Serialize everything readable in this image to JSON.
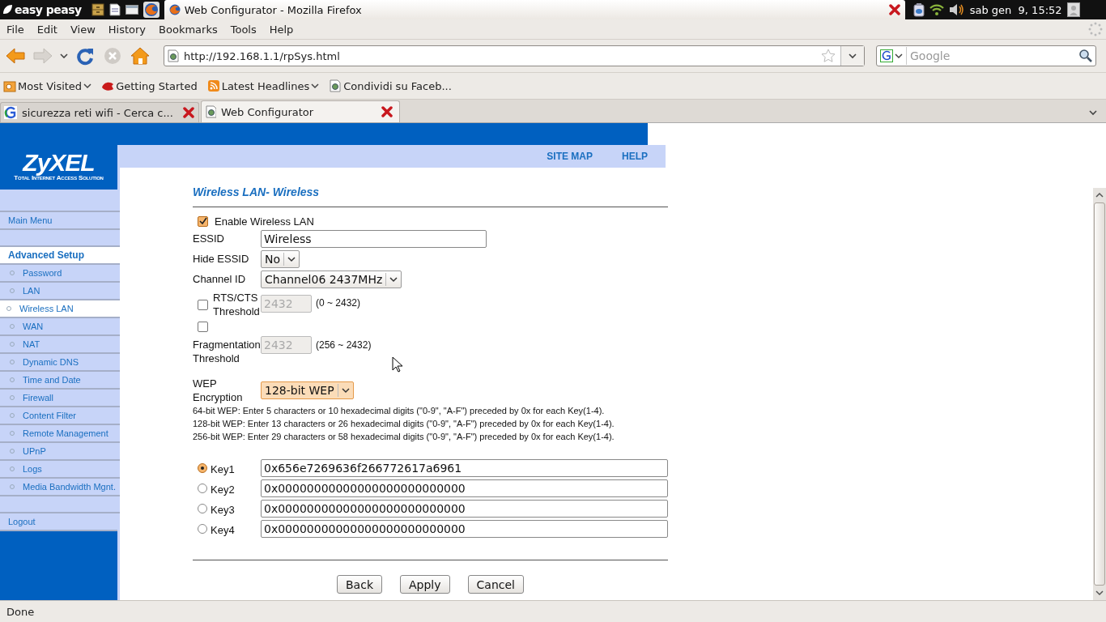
{
  "panel": {
    "menu_label": "easy peasy",
    "window_title": "Web Configurator - Mozilla Firefox",
    "clock": "sab gen  9, 15:52"
  },
  "menubar": [
    "File",
    "Edit",
    "View",
    "History",
    "Bookmarks",
    "Tools",
    "Help"
  ],
  "navigation": {
    "url": "http://192.168.1.1/rpSys.html",
    "search_placeholder": "Google"
  },
  "bookmarks": [
    {
      "label": "Most Visited",
      "kind": "folder",
      "dropdown": true
    },
    {
      "label": "Getting Started",
      "kind": "start",
      "dropdown": false
    },
    {
      "label": "Latest Headlines",
      "kind": "feed",
      "dropdown": true
    },
    {
      "label": "Condividi su Faceb...",
      "kind": "page",
      "dropdown": false
    }
  ],
  "tabs": [
    {
      "label": "sicurezza reti wifi - Cerca c...",
      "kind": "search",
      "selected": false
    },
    {
      "label": "Web Configurator",
      "kind": "page",
      "selected": true
    }
  ],
  "page": {
    "logo": {
      "name": "ZyXEL",
      "tagline": "Total Internet Access Solution"
    },
    "header_links": [
      "SITE MAP",
      "HELP"
    ],
    "sidebar": [
      {
        "kind": "link",
        "label": "Main Menu"
      },
      {
        "kind": "blank"
      },
      {
        "kind": "heading",
        "label": "Advanced Setup"
      },
      {
        "kind": "sub",
        "label": "Password",
        "selected": false
      },
      {
        "kind": "sub",
        "label": "LAN",
        "selected": false
      },
      {
        "kind": "sub",
        "label": "Wireless LAN",
        "selected": true
      },
      {
        "kind": "sub",
        "label": "WAN",
        "selected": false
      },
      {
        "kind": "sub",
        "label": "NAT",
        "selected": false
      },
      {
        "kind": "sub",
        "label": "Dynamic DNS",
        "selected": false
      },
      {
        "kind": "sub",
        "label": "Time and Date",
        "selected": false
      },
      {
        "kind": "sub",
        "label": "Firewall",
        "selected": false
      },
      {
        "kind": "sub",
        "label": "Content Filter",
        "selected": false
      },
      {
        "kind": "sub",
        "label": "Remote Management",
        "selected": false
      },
      {
        "kind": "sub",
        "label": "UPnP",
        "selected": false
      },
      {
        "kind": "sub",
        "label": "Logs",
        "selected": false
      },
      {
        "kind": "sub",
        "label": "Media Bandwidth Mgnt.",
        "selected": false
      },
      {
        "kind": "blank"
      },
      {
        "kind": "link",
        "label": "Logout"
      }
    ],
    "form": {
      "title": "Wireless LAN- Wireless",
      "enable": {
        "label": "Enable Wireless LAN",
        "checked": true
      },
      "essid": {
        "label": "ESSID",
        "value": "Wireless"
      },
      "hide_essid": {
        "label": "Hide ESSID",
        "value": "No"
      },
      "channel": {
        "label": "Channel ID",
        "value": "Channel06 2437MHz"
      },
      "rts": {
        "label": "RTS/CTS Threshold",
        "checked": false,
        "value": "2432",
        "disabled": true,
        "range": "(0 ~ 2432)"
      },
      "fragmentation": {
        "label": "Fragmentation Threshold",
        "checked": false,
        "value": "2432",
        "disabled": true,
        "range": "(256 ~ 2432)"
      },
      "wep": {
        "label": "WEP Encryption",
        "value": "128-bit WEP"
      },
      "notes": [
        "64-bit WEP: Enter 5 characters or 10 hexadecimal digits (\"0-9\", \"A-F\") preceded by 0x for each Key(1-4).",
        "128-bit WEP: Enter 13 characters or 26 hexadecimal digits (\"0-9\", \"A-F\") preceded by 0x for each Key(1-4).",
        "256-bit WEP: Enter 29 characters or 58 hexadecimal digits (\"0-9\", \"A-F\") preceded by 0x for each Key(1-4)."
      ],
      "keys": [
        {
          "label": "Key1",
          "value": "0x656e7269636f266772617a6961",
          "selected": true
        },
        {
          "label": "Key2",
          "value": "0x00000000000000000000000000",
          "selected": false
        },
        {
          "label": "Key3",
          "value": "0x00000000000000000000000000",
          "selected": false
        },
        {
          "label": "Key4",
          "value": "0x00000000000000000000000000",
          "selected": false
        }
      ],
      "buttons": [
        "Back",
        "Apply",
        "Cancel"
      ]
    }
  },
  "status_bar": "Done"
}
